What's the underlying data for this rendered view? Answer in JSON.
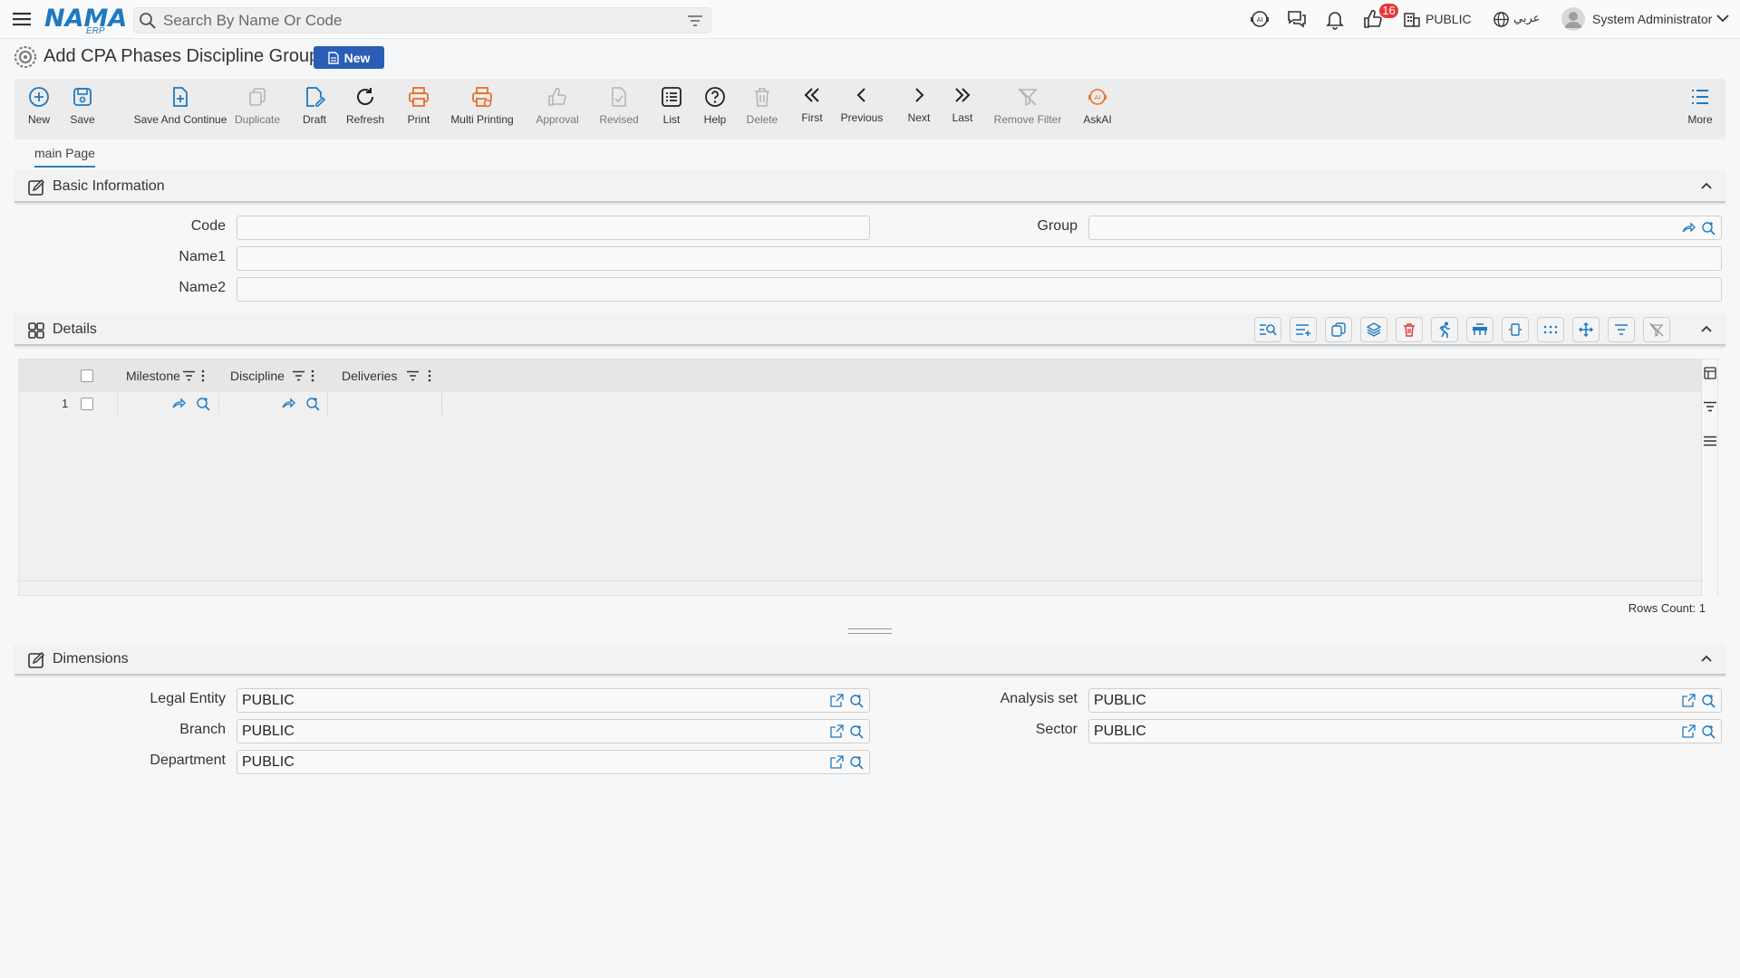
{
  "app": {
    "logo_main": "NAMA",
    "logo_sub": "ERP",
    "search_placeholder": "Search By Name Or Code",
    "notification_count": "16",
    "company": "PUBLIC",
    "language": "عربي",
    "user": "System Administrator"
  },
  "page": {
    "title": "Add CPA Phases Discipline Group",
    "status_badge": "New"
  },
  "toolbar": {
    "new": "New",
    "save": "Save",
    "save_continue": "Save And Continue",
    "duplicate": "Duplicate",
    "draft": "Draft",
    "refresh": "Refresh",
    "print": "Print",
    "multi_printing": "Multi Printing",
    "approval": "Approval",
    "revised": "Revised",
    "list": "List",
    "help": "Help",
    "delete": "Delete",
    "first": "First",
    "previous": "Previous",
    "next": "Next",
    "last": "Last",
    "remove_filter": "Remove Filter",
    "askai": "AskAI",
    "more": "More"
  },
  "tabs": {
    "main": "main Page"
  },
  "basic_info": {
    "title": "Basic Information",
    "code_label": "Code",
    "code_value": "",
    "group_label": "Group",
    "group_value": "",
    "name1_label": "Name1",
    "name1_value": "",
    "name2_label": "Name2",
    "name2_value": ""
  },
  "details": {
    "title": "Details",
    "columns": [
      "Milestone",
      "Discipline",
      "Deliveries"
    ],
    "rows": [
      {
        "num": "1",
        "milestone": "",
        "discipline": "",
        "deliveries": ""
      }
    ],
    "rows_count_label": "Rows Count:",
    "rows_count": "1"
  },
  "dimensions": {
    "title": "Dimensions",
    "legal_entity_label": "Legal Entity",
    "legal_entity_value": "PUBLIC",
    "analysis_set_label": "Analysis set",
    "analysis_set_value": "PUBLIC",
    "branch_label": "Branch",
    "branch_value": "PUBLIC",
    "sector_label": "Sector",
    "sector_value": "PUBLIC",
    "department_label": "Department",
    "department_value": "PUBLIC"
  },
  "colors": {
    "accent_blue": "#1f79c0",
    "badge_blue": "#2a5db5",
    "print_orange": "#e8702a",
    "delete_red": "#e53935"
  }
}
